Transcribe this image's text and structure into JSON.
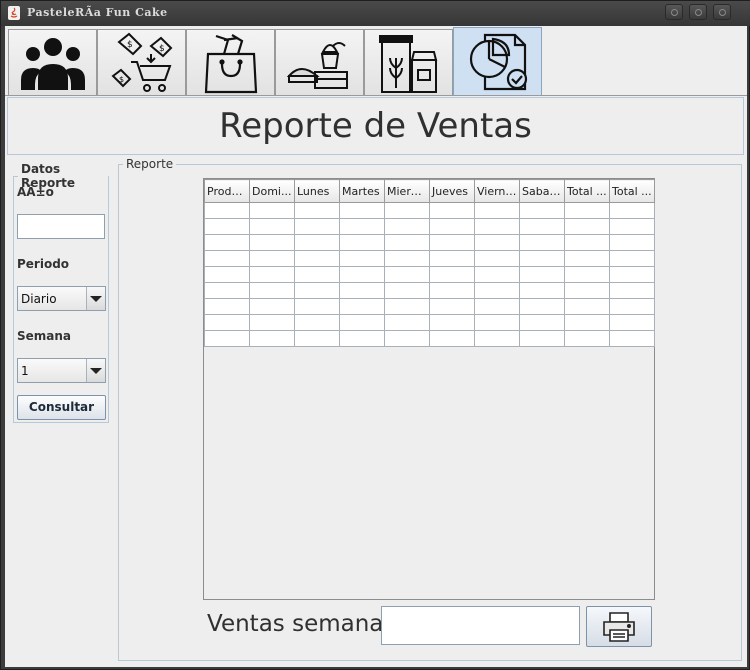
{
  "window": {
    "title": "PasteleRÃ­a Fun Cake"
  },
  "tabs": [
    {
      "icon": "users-icon",
      "active": false
    },
    {
      "icon": "sale-cart-icon",
      "active": false
    },
    {
      "icon": "shopping-bag-icon",
      "active": false
    },
    {
      "icon": "cakes-icon",
      "active": false
    },
    {
      "icon": "ingredients-icon",
      "active": false
    },
    {
      "icon": "report-chart-icon",
      "active": true
    }
  ],
  "header": {
    "title": "Reporte de Ventas"
  },
  "datos": {
    "legend": "Datos Reporte",
    "anio_label": "AÃ±o",
    "anio_value": "",
    "periodo_label": "Periodo",
    "periodo_value": "Diario",
    "semana_label": "Semana",
    "semana_value": "1",
    "consultar_label": "Consultar"
  },
  "reporte": {
    "legend": "Reporte",
    "columns": [
      "Produ...",
      "Domi...",
      "Lunes",
      "Martes",
      "Mierc...",
      "Jueves",
      "Viernes",
      "Sabado",
      "Total ...",
      "Total ..."
    ],
    "row_count": 9
  },
  "footer": {
    "ventas_label": "Ventas semanal",
    "ventas_value": "",
    "print_icon": "printer-icon"
  }
}
